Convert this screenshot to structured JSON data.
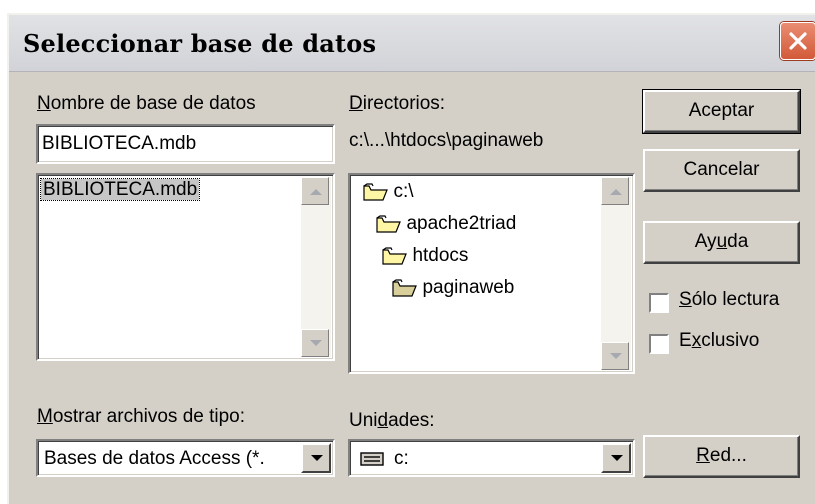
{
  "dialog": {
    "title": "Seleccionar base de datos",
    "close_icon": "close-x-icon"
  },
  "database": {
    "label": "Nombre de base de datos",
    "label_underline": "N",
    "label_rest": "ombre de base de datos",
    "value": "BIBLIOTECA.mdb",
    "files": [
      "BIBLIOTECA.mdb"
    ]
  },
  "directories": {
    "label_underline": "D",
    "label_rest": "irectorios:",
    "current_path": "c:\\...\\htdocs\\paginaweb",
    "tree": [
      {
        "name": "c:\\",
        "icon": "open-folder-icon",
        "level": 0
      },
      {
        "name": "apache2triad",
        "icon": "open-folder-icon",
        "level": 1
      },
      {
        "name": "htdocs",
        "icon": "open-folder-icon",
        "level": 2
      },
      {
        "name": "paginaweb",
        "icon": "open-folder-icon",
        "level": 3
      }
    ]
  },
  "buttons": {
    "accept": "Aceptar",
    "cancel": "Cancelar",
    "help_a": "Ay",
    "help_u": "u",
    "help_b": "da",
    "network_u": "R",
    "network_rest": "ed..."
  },
  "options": {
    "readonly_u": "S",
    "readonly_rest": "ólo lectura",
    "readonly_checked": false,
    "exclusive_a": "E",
    "exclusive_u": "x",
    "exclusive_rest": "clusivo",
    "exclusive_checked": false
  },
  "file_type": {
    "label_u": "M",
    "label_rest": "ostrar archivos de tipo:",
    "value": "Bases de datos Access (*."
  },
  "drives": {
    "label_a": "Uni",
    "label_u": "d",
    "label_rest": "ades:",
    "value": "c:",
    "icon": "drive-icon"
  },
  "colors": {
    "dialog_bg": "#d4d0c8",
    "close_button": "#d25a39"
  }
}
